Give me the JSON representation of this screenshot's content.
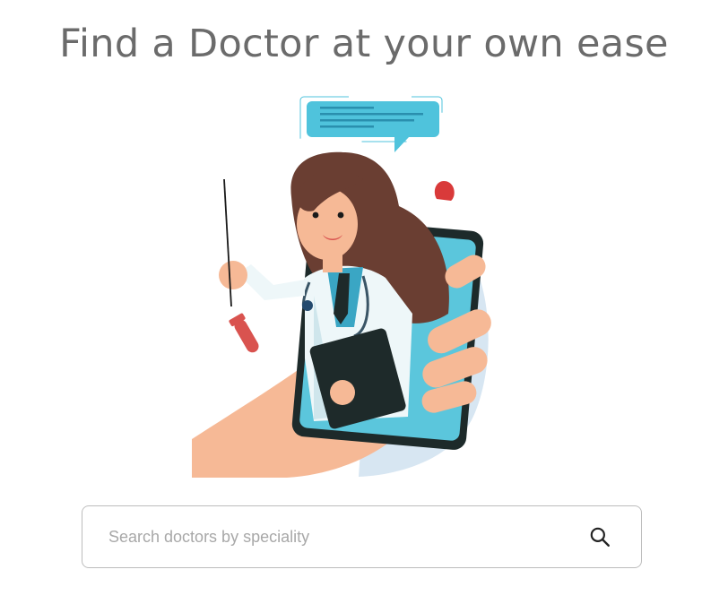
{
  "header": {
    "title": "Find a Doctor at your own ease"
  },
  "hero": {
    "illustration": "doctor-on-phone-illustration"
  },
  "search": {
    "placeholder": "Search doctors by speciality",
    "value": "",
    "icon": "search-icon"
  },
  "colors": {
    "title_text": "#6b6b6b",
    "input_border": "#bdbdbd",
    "placeholder": "#a8a8a8",
    "chat_bubble": "#4fc3dc"
  }
}
